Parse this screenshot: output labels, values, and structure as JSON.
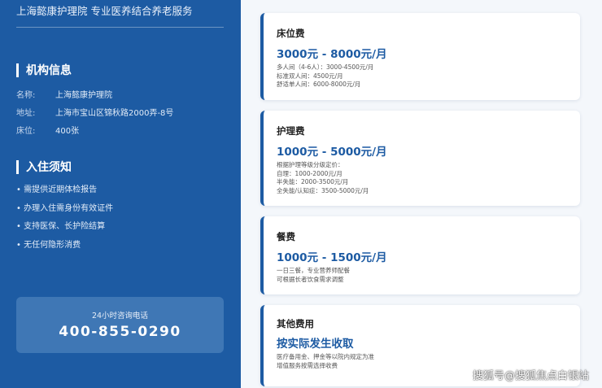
{
  "sidebar": {
    "brand": "上海懿康护理院 专业医养结合养老服务",
    "info": {
      "title": "机构信息",
      "rows": [
        {
          "label": "名称:",
          "value": "上海懿康护理院"
        },
        {
          "label": "地址:",
          "value": "上海市宝山区锦秋路2000弄-8号"
        },
        {
          "label": "床位:",
          "value": "400张"
        }
      ]
    },
    "notice": {
      "title": "入住须知",
      "items": [
        "• 需提供近期体检报告",
        "• 办理入住需身份有效证件",
        "• 支持医保、长护险结算",
        "• 无任何隐形消费"
      ]
    },
    "hotline": {
      "label": "24小时咨询电话",
      "number": "400-855-0290"
    }
  },
  "cards": [
    {
      "title": "床位费",
      "price": "3000元 - 8000元/月",
      "lines": [
        "多人间（4-6人）：3000-4500元/月",
        "标准双人间：4500元/月",
        "舒适单人间：6000-8000元/月"
      ]
    },
    {
      "title": "护理费",
      "price": "1000元 - 5000元/月",
      "lines": [
        "根据护理等级分级定价：",
        "自理：1000-2000元/月",
        "半失能：2000-3500元/月",
        "全失能/认知症：3500-5000元/月"
      ]
    },
    {
      "title": "餐费",
      "price": "1000元 - 1500元/月",
      "lines": [
        "一日三餐，专业营养师配餐",
        "可根据长者饮食需求调整"
      ]
    },
    {
      "title": "其他费用",
      "price": "按实际发生收取",
      "lines": [
        "医疗备用金、押金等以院内规定为准",
        "增值服务按需选择收费"
      ]
    }
  ],
  "watermark": "搜狐号@搜狐焦点白银站",
  "colors": {
    "sidebar_bg": "#1d5ba3",
    "accent": "#1d5ba3",
    "hotline_bg": "#3f77b5",
    "page_bg": "#f4f7fb"
  }
}
